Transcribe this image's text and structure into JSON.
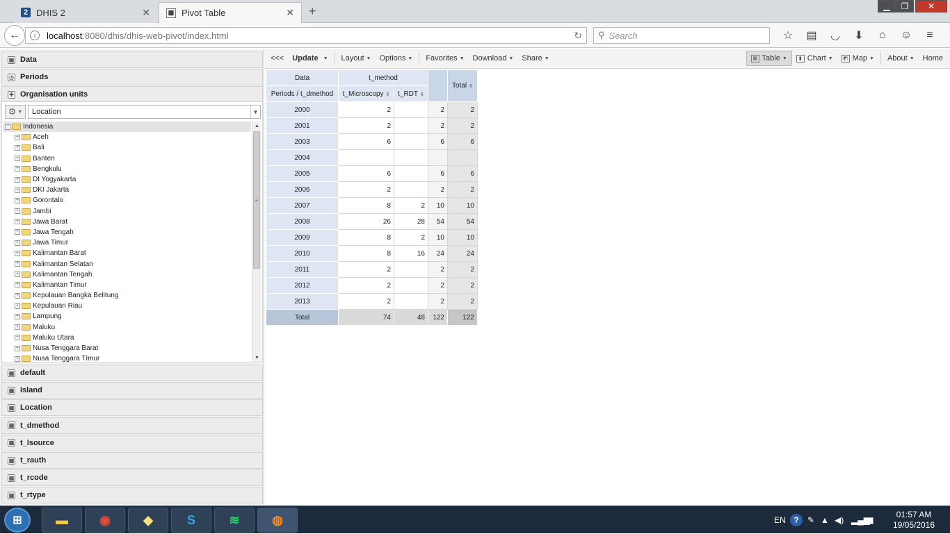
{
  "browser": {
    "tabs": [
      {
        "title": "DHIS 2",
        "favicon": "2"
      },
      {
        "title": "Pivot Table"
      }
    ],
    "url_host": "localhost",
    "url_path": ":8080/dhis/dhis-web-pivot/index.html",
    "search_placeholder": "Search"
  },
  "west": {
    "top_sections": [
      "Data",
      "Periods",
      "Organisation units"
    ],
    "ou_select": "Location",
    "tree_root": "Indonesia",
    "tree_items": [
      "Aceh",
      "Bali",
      "Banten",
      "Bengkulu",
      "DI Yogyakarta",
      "DKI Jakarta",
      "Gorontalo",
      "Jambi",
      "Jawa Barat",
      "Jawa Tengah",
      "Jawa Timur",
      "Kalimantan Barat",
      "Kalimantan Selatan",
      "Kalimantan Tengah",
      "Kalimantan Timur",
      "Kepulauan Bangka Belitung",
      "Kepulauan Riau",
      "Lampung",
      "Maluku",
      "Maluku Utara",
      "Nusa Tenggara Barat",
      "Nusa Tenggara TImur"
    ],
    "bottom_sections": [
      "default",
      "Island",
      "Location",
      "t_dmethod",
      "t_lsource",
      "t_rauth",
      "t_rcode",
      "t_rtype"
    ]
  },
  "toolbar": {
    "collapse": "<<<",
    "update": "Update",
    "layout": "Layout",
    "options": "Options",
    "favorites": "Favorites",
    "download": "Download",
    "share": "Share",
    "table": "Table",
    "chart": "Chart",
    "map": "Map",
    "about": "About",
    "home": "Home"
  },
  "pivot": {
    "corner_top": "Data",
    "column_group": "t_method",
    "corner_bottom": "Periods / t_dmethod",
    "columns": [
      "t_Microscopy",
      "t_RDT"
    ],
    "total_label": "Total",
    "rows": [
      {
        "period": "2000",
        "micro": "2",
        "rdt": "",
        "sub": "2",
        "total": "2"
      },
      {
        "period": "2001",
        "micro": "2",
        "rdt": "",
        "sub": "2",
        "total": "2"
      },
      {
        "period": "2003",
        "micro": "6",
        "rdt": "",
        "sub": "6",
        "total": "6"
      },
      {
        "period": "2004",
        "micro": "",
        "rdt": "",
        "sub": "",
        "total": ""
      },
      {
        "period": "2005",
        "micro": "6",
        "rdt": "",
        "sub": "6",
        "total": "6"
      },
      {
        "period": "2006",
        "micro": "2",
        "rdt": "",
        "sub": "2",
        "total": "2"
      },
      {
        "period": "2007",
        "micro": "8",
        "rdt": "2",
        "sub": "10",
        "total": "10"
      },
      {
        "period": "2008",
        "micro": "26",
        "rdt": "28",
        "sub": "54",
        "total": "54"
      },
      {
        "period": "2009",
        "micro": "8",
        "rdt": "2",
        "sub": "10",
        "total": "10"
      },
      {
        "period": "2010",
        "micro": "8",
        "rdt": "16",
        "sub": "24",
        "total": "24"
      },
      {
        "period": "2011",
        "micro": "2",
        "rdt": "",
        "sub": "2",
        "total": "2"
      },
      {
        "period": "2012",
        "micro": "2",
        "rdt": "",
        "sub": "2",
        "total": "2"
      },
      {
        "period": "2013",
        "micro": "2",
        "rdt": "",
        "sub": "2",
        "total": "2"
      }
    ],
    "totals": {
      "label": "Total",
      "micro": "74",
      "rdt": "48",
      "sub": "122",
      "total": "122"
    }
  },
  "taskbar": {
    "lang": "EN",
    "time": "01:57 AM",
    "date": "19/05/2016"
  }
}
